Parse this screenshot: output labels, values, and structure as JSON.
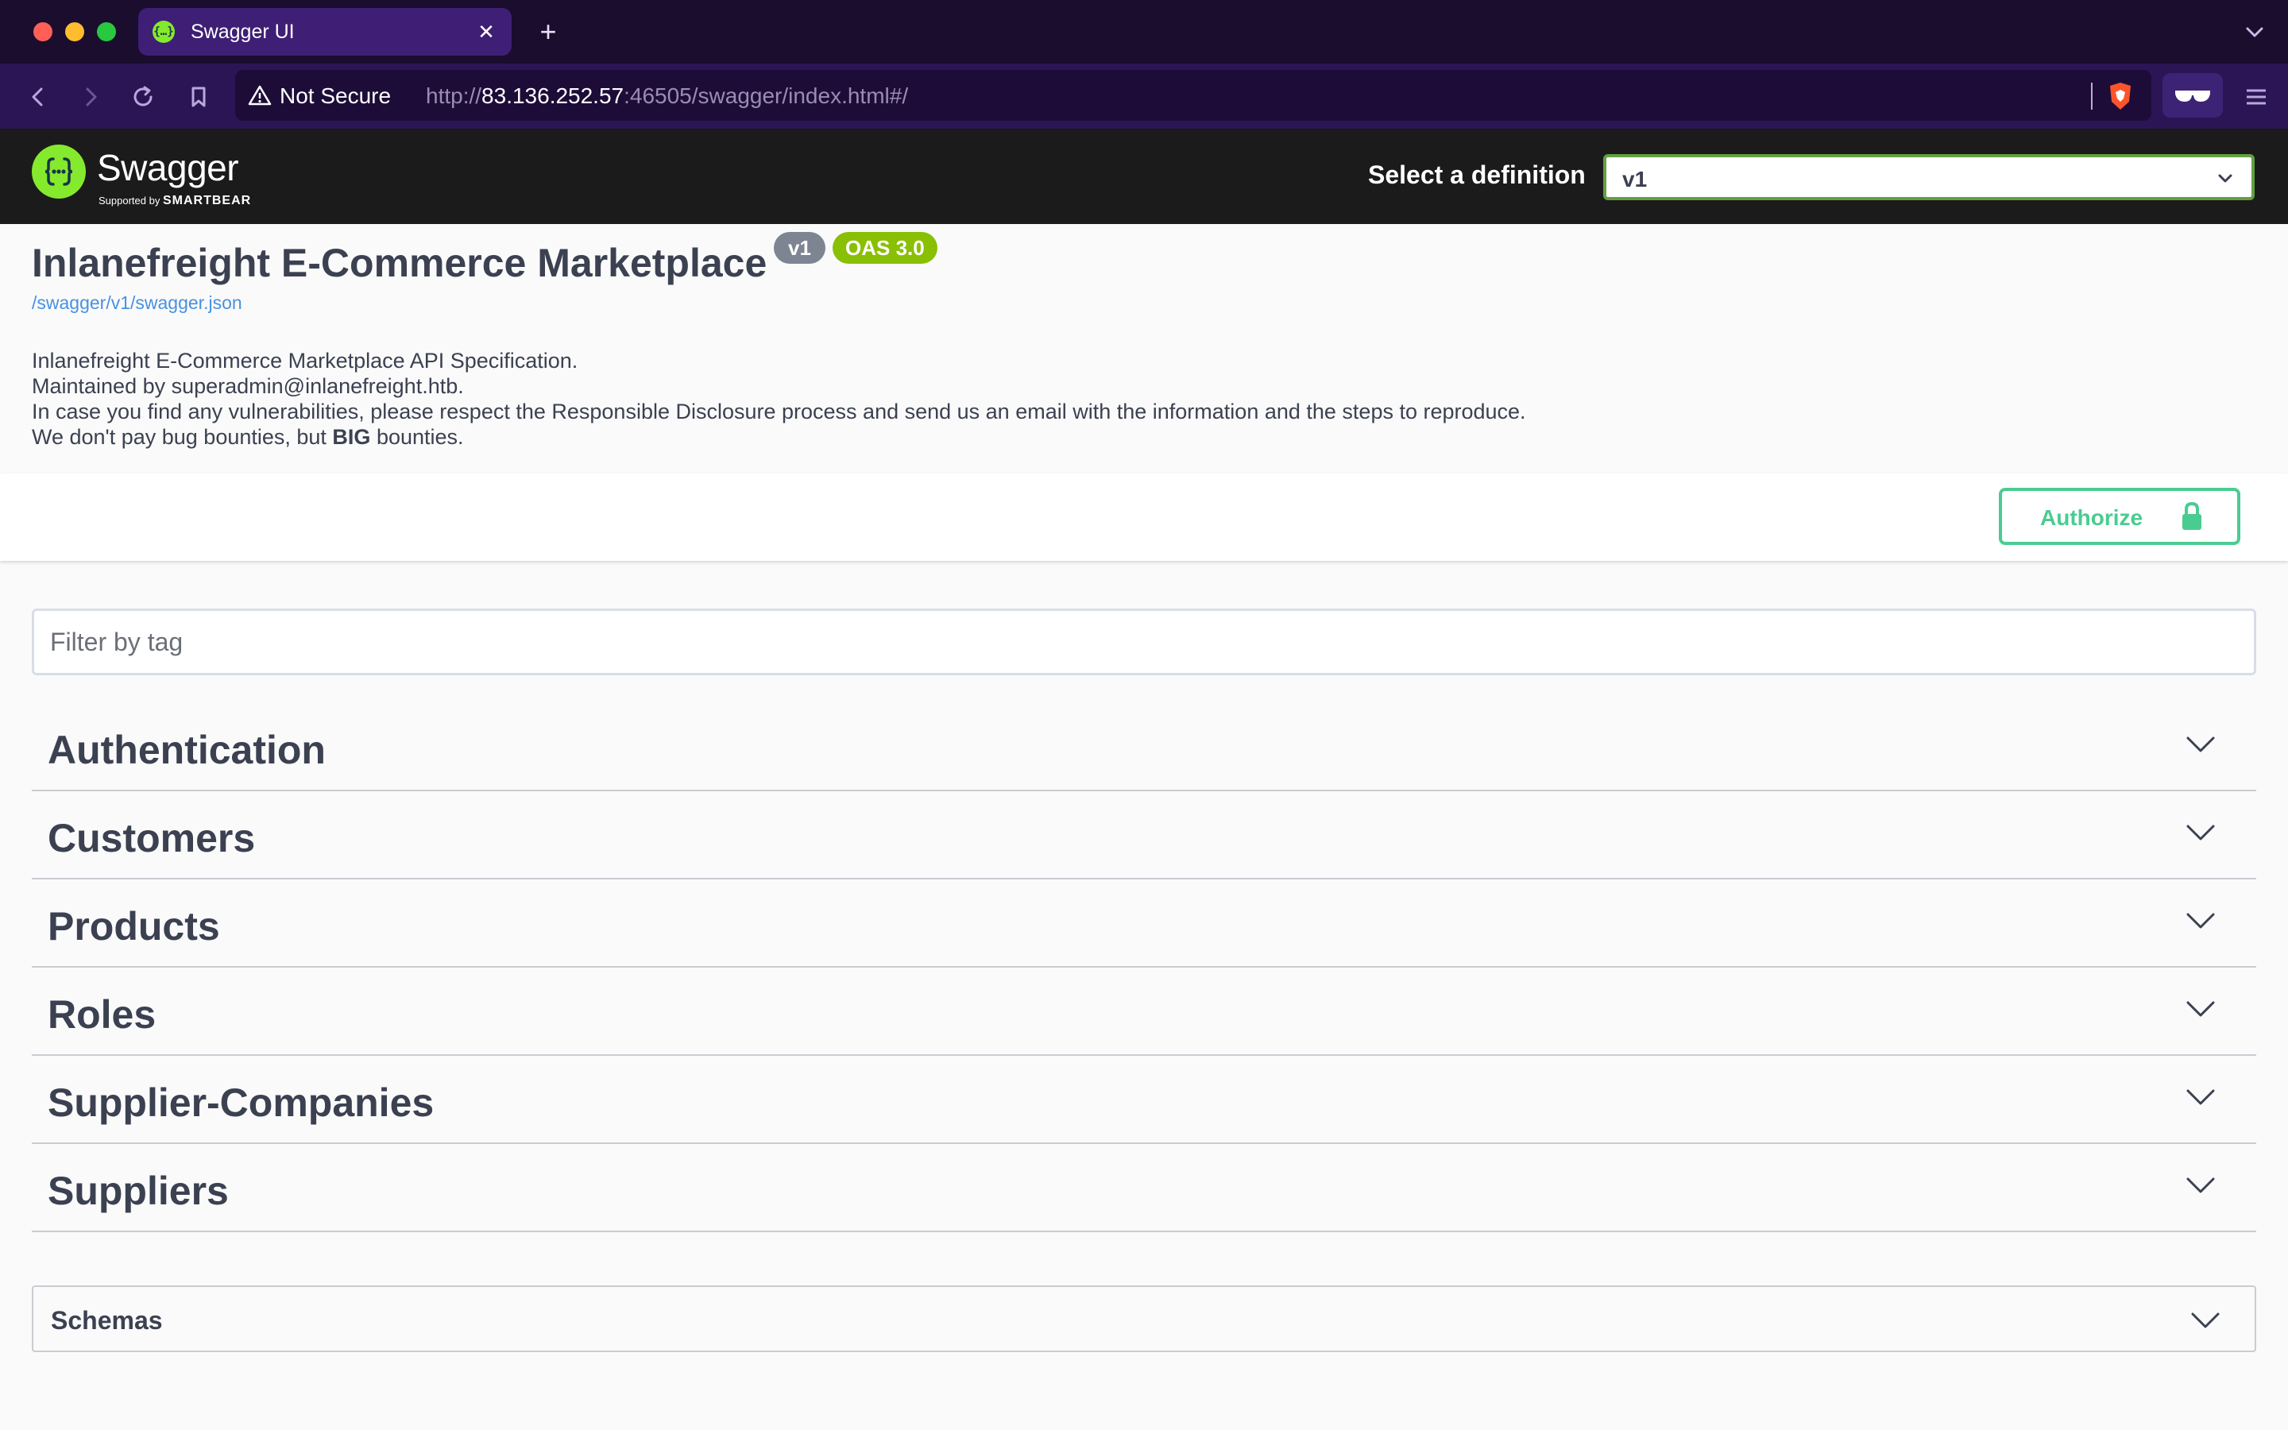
{
  "browser": {
    "tab_title": "Swagger UI",
    "tab_close": "✕",
    "new_tab": "+",
    "security_label": "Not Secure",
    "url_scheme": "http://",
    "url_host": "83.136.252.57",
    "url_rest": ":46505/swagger/index.html#/"
  },
  "swagger": {
    "logo_text": "Swagger",
    "logo_sub_prefix": "Supported by",
    "logo_sub_brand": "SMARTBEAR",
    "definition_label": "Select a definition",
    "definition_value": "v1"
  },
  "info": {
    "title": "Inlanefreight E-Commerce Marketplace",
    "version_badge": "v1",
    "oas_badge": "OAS 3.0",
    "spec_link": "/swagger/v1/swagger.json",
    "description": {
      "line1": "Inlanefreight E-Commerce Marketplace API Specification.",
      "line2": "Maintained by superadmin@inlanefreight.htb.",
      "line3": "In case you find any vulnerabilities, please respect the Responsible Disclosure process and send us an email with the information and the steps to reproduce.",
      "line4_prefix": "We don't pay bug bounties, but ",
      "line4_bold": "BIG",
      "line4_suffix": " bounties."
    }
  },
  "authorize": {
    "label": "Authorize"
  },
  "filter": {
    "placeholder": "Filter by tag"
  },
  "tags": [
    {
      "name": "Authentication"
    },
    {
      "name": "Customers"
    },
    {
      "name": "Products"
    },
    {
      "name": "Roles"
    },
    {
      "name": "Supplier-Companies"
    },
    {
      "name": "Suppliers"
    }
  ],
  "schemas": {
    "label": "Schemas"
  },
  "colors": {
    "accent_green": "#49cc90",
    "swagger_green": "#85ea2d",
    "oas_green": "#89bf04",
    "text": "#3b4151",
    "link": "#4990e2"
  }
}
